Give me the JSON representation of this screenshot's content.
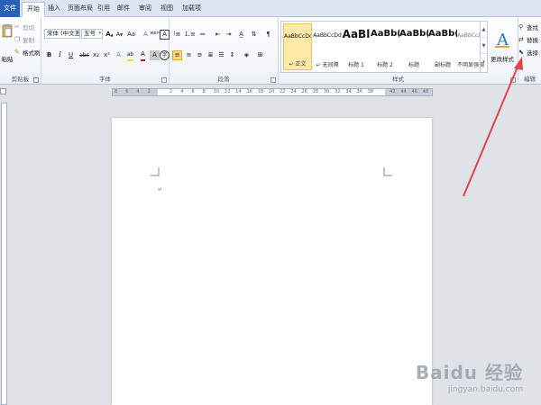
{
  "tabs": [
    "文件",
    "开始",
    "插入",
    "页面布局",
    "引用",
    "邮件",
    "审阅",
    "视图",
    "加载项"
  ],
  "clipboard": {
    "paste": "粘贴",
    "cut": "剪切",
    "copy": "复制",
    "format_painter": "格式刷",
    "group_label": "剪贴板"
  },
  "font": {
    "font_name": "宋体 (中文正)",
    "font_size": "五号",
    "grow": "A",
    "shrink": "A",
    "change_case": "Aa",
    "clear_format": "A",
    "pinyin": "wén",
    "border_char": "A",
    "bold": "B",
    "italic": "I",
    "underline": "U",
    "strike": "abc",
    "subscript": "x₂",
    "superscript": "x²",
    "text_effect": "A",
    "highlight": "ab",
    "font_color": "A",
    "char_shading": "A",
    "enclose": "字",
    "group_label": "字体"
  },
  "paragraph": {
    "group_label": "段落"
  },
  "styles": {
    "items": [
      {
        "sample": "AaBbCcDd",
        "name": "↵ 正文",
        "selected": true
      },
      {
        "sample": "AaBbCcDd",
        "name": "↵ 无间隔",
        "selected": false
      },
      {
        "sample": "AaBl",
        "name": "标题 1",
        "selected": false
      },
      {
        "sample": "AaBb(",
        "name": "标题 2",
        "selected": false
      },
      {
        "sample": "AaBb(",
        "name": "标题",
        "selected": false
      },
      {
        "sample": "AaBb(",
        "name": "副标题",
        "selected": false
      },
      {
        "sample": "AaBbCcDd",
        "name": "不明显强调",
        "selected": false
      }
    ],
    "change_styles": "更改样式",
    "group_label": "样式"
  },
  "editing": {
    "find": "查找",
    "replace": "替换",
    "select": "选择",
    "group_label": "编辑"
  },
  "ruler": {
    "numbers": [
      "8",
      "6",
      "4",
      "2",
      "",
      "2",
      "4",
      "6",
      "8",
      "10",
      "12",
      "14",
      "16",
      "18",
      "20",
      "22",
      "24",
      "26",
      "28",
      "30",
      "32",
      "34",
      "36",
      "38",
      "",
      "42",
      "44",
      "46",
      "48"
    ]
  },
  "page": {
    "paragraph_mark": "↵"
  },
  "watermark": {
    "logo": "Baidu 经验",
    "url": "jingyan.baidu.com"
  },
  "colors": {
    "file_tab": "#2a62b8",
    "arrow": "#e0454a",
    "highlight_yellow": "#f5e000",
    "font_red": "#d01010"
  }
}
